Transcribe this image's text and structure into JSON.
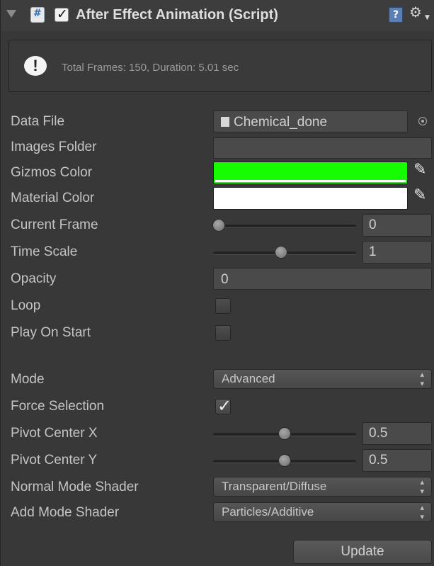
{
  "header": {
    "title": "After Effect Animation (Script)",
    "enabled": true
  },
  "info": {
    "message": "Total Frames: 150, Duration: 5.01 sec"
  },
  "fields": {
    "data_file": {
      "label": "Data File",
      "value": "Chemical_done"
    },
    "images_folder": {
      "label": "Images Folder",
      "value": ""
    },
    "gizmos_color": {
      "label": "Gizmos Color",
      "color": "#16fd00"
    },
    "material_color": {
      "label": "Material Color",
      "color": "#ffffff"
    },
    "current_frame": {
      "label": "Current Frame",
      "value": "0",
      "slider_fraction": 0.0
    },
    "time_scale": {
      "label": "Time Scale",
      "value": "1",
      "slider_fraction": 0.47
    },
    "opacity": {
      "label": "Opacity",
      "value": "0"
    },
    "loop": {
      "label": "Loop",
      "checked": false
    },
    "play_on_start": {
      "label": "Play On Start",
      "checked": false
    },
    "mode": {
      "label": "Mode",
      "value": "Advanced"
    },
    "force_selection": {
      "label": "Force Selection",
      "checked": true
    },
    "pivot_center_x": {
      "label": "Pivot Center X",
      "value": "0.5",
      "slider_fraction": 0.5
    },
    "pivot_center_y": {
      "label": "Pivot Center Y",
      "value": "0.5",
      "slider_fraction": 0.5
    },
    "normal_mode_shader": {
      "label": "Normal Mode Shader",
      "value": "Transparent/Diffuse"
    },
    "add_mode_shader": {
      "label": "Add Mode Shader",
      "value": "Particles/Additive"
    }
  },
  "buttons": {
    "update": "Update"
  }
}
